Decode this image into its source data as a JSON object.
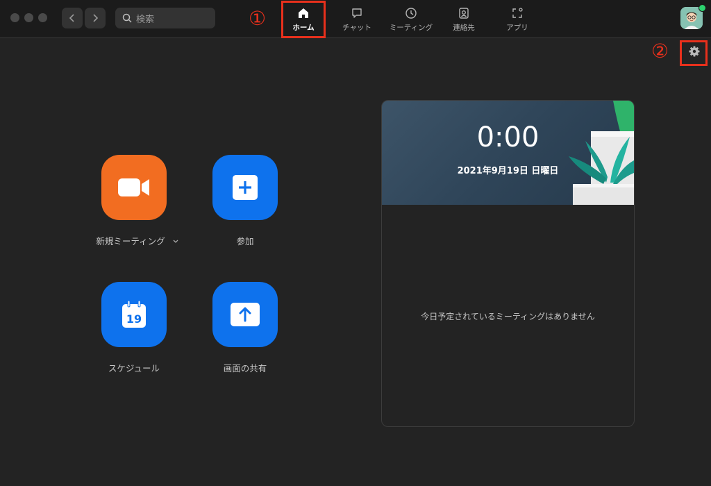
{
  "search": {
    "placeholder": "検索"
  },
  "tabs": [
    {
      "label": "ホーム",
      "icon": "home-icon"
    },
    {
      "label": "チャット",
      "icon": "chat-icon"
    },
    {
      "label": "ミーティング",
      "icon": "clock-icon"
    },
    {
      "label": "連絡先",
      "icon": "contacts-icon"
    },
    {
      "label": "アプリ",
      "icon": "apps-icon"
    }
  ],
  "annotations": {
    "one": "①",
    "two": "②"
  },
  "actions": {
    "new_meeting": "新規ミーティング",
    "join": "参加",
    "schedule": "スケジュール",
    "schedule_day": "19",
    "share": "画面の共有"
  },
  "meeting_card": {
    "time": "0:00",
    "date": "2021年9月19日 日曜日",
    "empty_message": "今日予定されているミーティングはありません"
  },
  "colors": {
    "accent_orange": "#f26d21",
    "accent_blue": "#0e72ed",
    "highlight_red": "#e8301c",
    "online_green": "#2dd36f"
  }
}
